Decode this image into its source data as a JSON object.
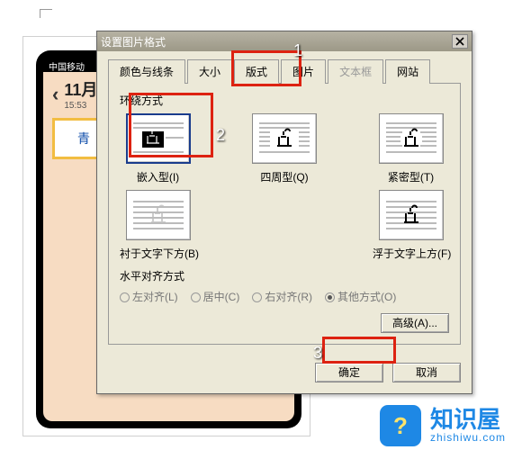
{
  "phone": {
    "status": "中国移动",
    "month": "11月",
    "time": "15:53",
    "selected": "青"
  },
  "dialog": {
    "title": "设置图片格式",
    "tabs": {
      "colors": "颜色与线条",
      "size": "大小",
      "layout": "版式",
      "picture": "图片",
      "textbox": "文本框",
      "web": "网站"
    },
    "wrap_group": "环绕方式",
    "wrap": {
      "inline": "嵌入型(I)",
      "square": "四周型(Q)",
      "tight": "紧密型(T)",
      "behind": "衬于文字下方(B)",
      "front": "浮于文字上方(F)"
    },
    "align_group": "水平对齐方式",
    "align": {
      "left": "左对齐(L)",
      "center": "居中(C)",
      "right": "右对齐(R)",
      "other": "其他方式(O)"
    },
    "advanced": "高级(A)...",
    "ok": "确定",
    "cancel": "取消"
  },
  "annotations": {
    "a1": "1",
    "a2": "2",
    "a3": "3"
  },
  "watermark": {
    "brand": "知识屋",
    "url": "zhishiwu.com",
    "icon": "?"
  }
}
